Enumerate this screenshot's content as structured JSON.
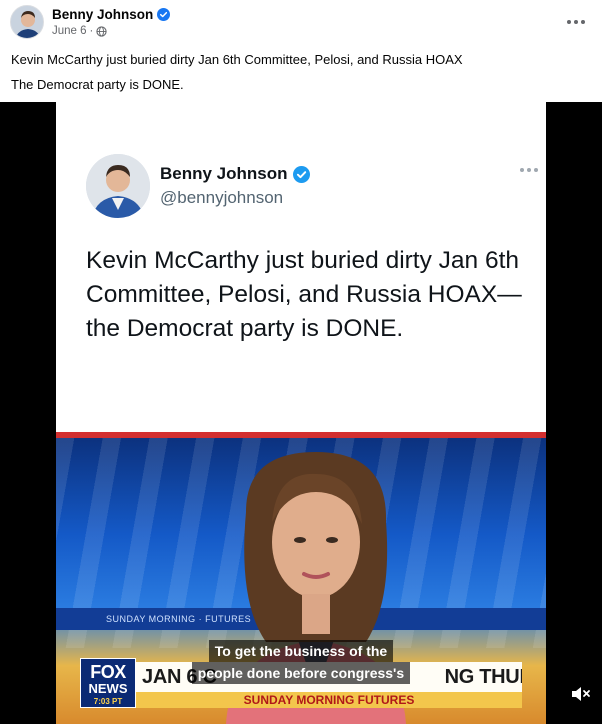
{
  "post": {
    "author": "Benny Johnson",
    "date": "June 6",
    "separator": "·",
    "text_lines": [
      "Kevin McCarthy just buried dirty Jan 6th Committee, Pelosi, and Russia HOAX",
      "The Democrat party is DONE."
    ]
  },
  "tweet": {
    "name": "Benny Johnson",
    "handle": "@bennyjohnson",
    "body": "Kevin McCarthy just buried dirty Jan 6th Committee, Pelosi, and Russia HOAX— the Democrat party is DONE."
  },
  "tv": {
    "logo_top": "FOX",
    "logo_bottom": "NEWS",
    "time": "7:03 PT",
    "headline": "JAN 6 C",
    "headline_end": "NG THURSDAY",
    "show_name": "SUNDAY MORNING FUTURES",
    "ticker": "SUNDAY MORNING   ·   FUTURES"
  },
  "caption": {
    "line1": "To get the business of the",
    "line2": "people done before congress's"
  },
  "colors": {
    "verified_blue": "#1877f2",
    "twitter_blue": "#1d9bf0",
    "fox_red": "#d32f2f"
  },
  "icons": {
    "verified": "verified-badge-icon",
    "audience": "globe-icon",
    "more": "more-options-icon",
    "mute": "muted-speaker-icon"
  }
}
